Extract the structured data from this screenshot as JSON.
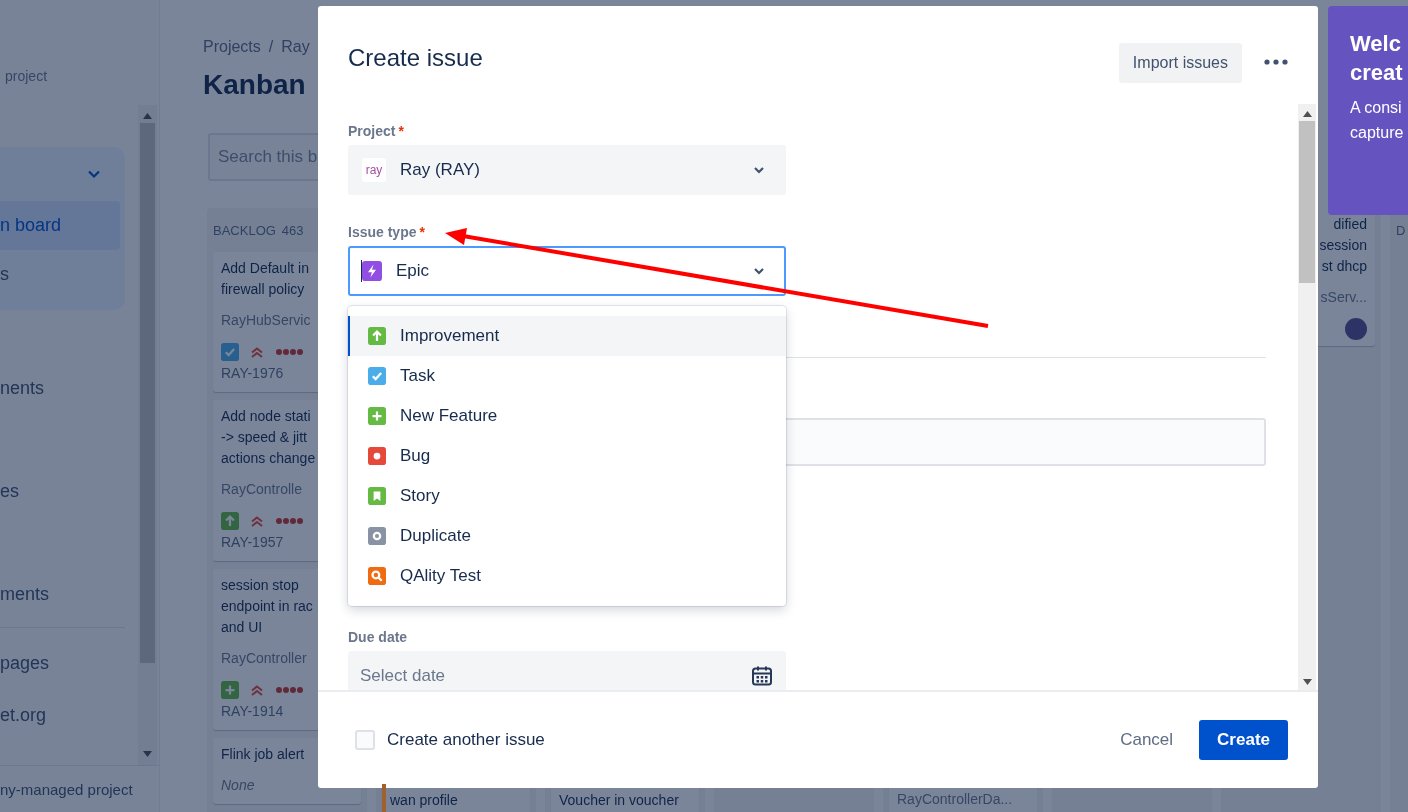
{
  "sidebar": {
    "project_label": "project",
    "nav_group": {
      "expanded": true,
      "items": [
        {
          "label": "n board",
          "selected": true
        },
        {
          "label": "s",
          "selected": false
        }
      ]
    },
    "items": [
      {
        "label": "nents",
        "selected": false,
        "divider_before": false
      },
      {
        "label": "es",
        "selected": false,
        "divider_before": false
      },
      {
        "label": "ments",
        "selected": false,
        "divider_before": false
      },
      {
        "label": "pages",
        "selected": false,
        "divider_before": true
      },
      {
        "label": "et.org",
        "selected": false,
        "divider_before": false
      }
    ],
    "footer": "ny-managed project"
  },
  "board": {
    "breadcrumb": [
      "Projects",
      "Ray"
    ],
    "breadcrumb_separator": "/",
    "title": "Kanban",
    "search": {
      "placeholder": "Search this b"
    },
    "columns": [
      {
        "title": "BACKLOG",
        "count": "463",
        "cards": [
          {
            "lines": [
              "Add Default in",
              "firewall policy"
            ],
            "component": "RayHubServic",
            "kind": "task",
            "priority": {
              "kind": "highest"
            },
            "key": "RAY-1976"
          },
          {
            "lines": [
              "Add node stati",
              "-> speed & jitt",
              "actions change"
            ],
            "component": "RayControlle",
            "kind": "improvement",
            "priority": {
              "kind": "highest"
            },
            "key": "RAY-1957"
          },
          {
            "lines": [
              "session stop",
              "endpoint in rac",
              "and UI"
            ],
            "component": "RayController",
            "kind": "new_feature",
            "priority": {
              "kind": "highest"
            },
            "key": "RAY-1914"
          },
          {
            "lines": [
              "Flink job alert"
            ],
            "component": "None",
            "component_empty": true
          }
        ]
      },
      {
        "cards": [
          {
            "lines": [
              "wan profile"
            ],
            "color": "#a0612f"
          }
        ]
      },
      {
        "cards": [
          {
            "lines": [
              "Voucher in voucher"
            ]
          }
        ]
      },
      {
        "cards": [
          {
            "component": "RayControllerDa..."
          }
        ]
      },
      {
        "cards": [
          {
            "lines": [
              "dified",
              "session",
              "st dhcp"
            ],
            "component": "sServ...",
            "assignee": true
          }
        ]
      },
      {
        "title": "D"
      }
    ]
  },
  "welcome": {
    "title_lines": [
      "Welc",
      "creat"
    ],
    "body_lines": [
      "A consi",
      "capture"
    ]
  },
  "dialog": {
    "title": "Create issue",
    "import_button": "Import issues",
    "fields": [
      {
        "kind": "select",
        "label": "Project",
        "required_mark": "*",
        "avatar": "ray",
        "value": "Ray (RAY)",
        "focused": false
      },
      {
        "kind": "select",
        "label": "Issue type",
        "required_mark": "*",
        "icon": {
          "kind": "epic"
        },
        "value": "Epic",
        "focused": true
      },
      {
        "kind": "divider"
      },
      {
        "kind": "text"
      },
      {
        "kind": "date",
        "label": "Due date",
        "placeholder": "Select date"
      }
    ],
    "dropdown": {
      "options": [
        {
          "label": "Improvement",
          "kind": "improvement",
          "selected": true
        },
        {
          "label": "Task",
          "kind": "task",
          "selected": false
        },
        {
          "label": "New Feature",
          "kind": "new_feature",
          "selected": false
        },
        {
          "label": "Bug",
          "kind": "bug",
          "selected": false
        },
        {
          "label": "Story",
          "kind": "story",
          "selected": false
        },
        {
          "label": "Duplicate",
          "kind": "duplicate",
          "selected": false
        },
        {
          "label": "QAlity Test",
          "kind": "qality",
          "selected": false
        }
      ]
    },
    "create_another": {
      "label": "Create another issue",
      "checked": false
    },
    "buttons": [
      {
        "label": "Cancel",
        "kind": "subtle"
      },
      {
        "label": "Create",
        "kind": "primary"
      }
    ]
  }
}
